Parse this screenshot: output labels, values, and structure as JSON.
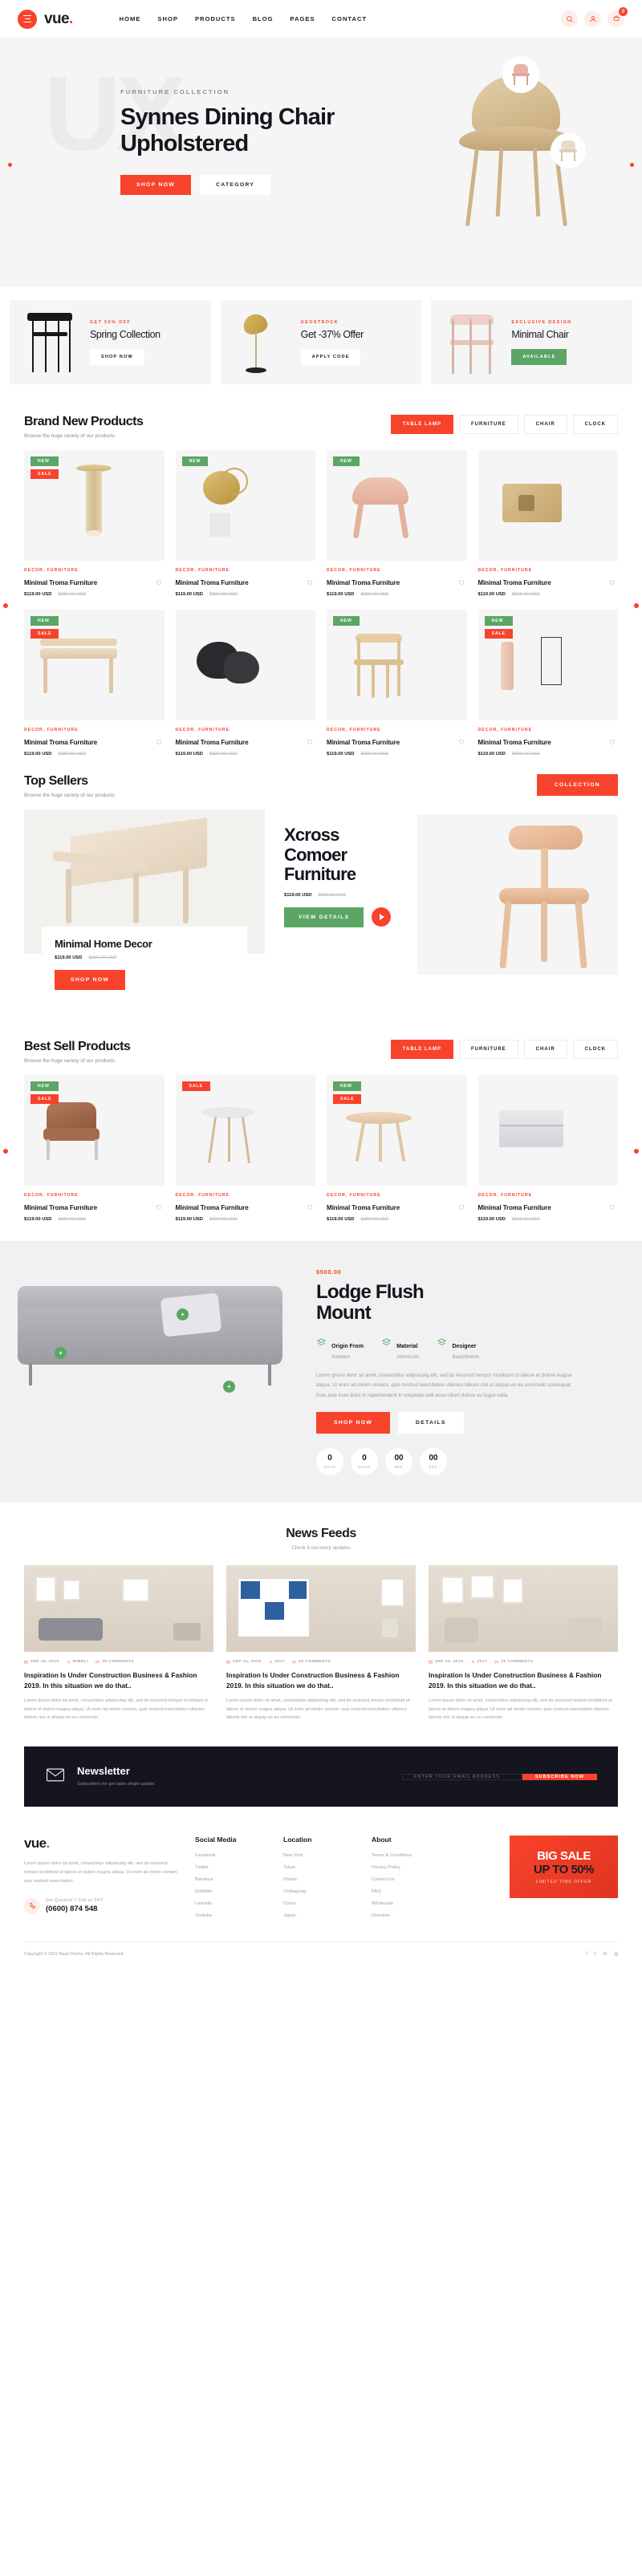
{
  "header": {
    "brand": "vue",
    "brand_dot": ".",
    "nav": [
      {
        "label": "HOME"
      },
      {
        "label": "SHOP"
      },
      {
        "label": "PRODUCTS"
      },
      {
        "label": "BLOG"
      },
      {
        "label": "PAGES"
      },
      {
        "label": "CONTACT"
      }
    ],
    "icons": {
      "search": "search-icon",
      "user": "user-icon",
      "cart": "cart-icon"
    },
    "cart_count": "0"
  },
  "hero": {
    "ghost_text": "UX",
    "kicker": "FURNITURE COLLECTION",
    "title": "Synnes Dining Chair Upholstered",
    "primary_btn": "SHOP NOW",
    "secondary_btn": "CATEGORY"
  },
  "promos": [
    {
      "kicker": "GET 50% OFF",
      "title": "Spring Collection",
      "btn": "SHOP NOW",
      "btn_style": "white"
    },
    {
      "kicker": "GEOSTROCK",
      "title": "Get -37% Offer",
      "btn": "APPLY CODE",
      "btn_style": "white"
    },
    {
      "kicker": "EXCLUSIVE DESIGN",
      "title": "Minimal Chair",
      "btn": "AVAILABLE",
      "btn_style": "green"
    }
  ],
  "brand_new": {
    "title": "Brand New Products",
    "subtitle": "Browse the huge variety of our products",
    "filters": [
      {
        "label": "TABLE LAMP",
        "active": true
      },
      {
        "label": "FURNITURE",
        "active": false
      },
      {
        "label": "CHAIR",
        "active": false
      },
      {
        "label": "CLOCK",
        "active": false
      }
    ],
    "products": [
      {
        "badges": [
          "NEW",
          "SALE"
        ],
        "category": "DECOR, FURNITURE",
        "name": "Minimal Troma Furniture",
        "price": "$119.00 USD",
        "price_old": "$330.00 USD"
      },
      {
        "badges": [
          "NEW"
        ],
        "category": "DECOR, FURNITURE",
        "name": "Minimal Troma Furniture",
        "price": "$119.00 USD",
        "price_old": "$330.00 USD"
      },
      {
        "badges": [
          "NEW"
        ],
        "category": "DECOR, FURNITURE",
        "name": "Minimal Troma Furniture",
        "price": "$119.00 USD",
        "price_old": "$330.00 USD"
      },
      {
        "badges": [],
        "category": "DECOR, FURNITURE",
        "name": "Minimal Troma Furniture",
        "price": "$119.00 USD",
        "price_old": "$330.00 USD"
      },
      {
        "badges": [
          "NEW",
          "SALE"
        ],
        "category": "DECOR, FURNITURE",
        "name": "Minimal Troma Furniture",
        "price": "$119.00 USD",
        "price_old": "$330.00 USD"
      },
      {
        "badges": [],
        "category": "DECOR, FURNITURE",
        "name": "Minimal Troma Furniture",
        "price": "$119.00 USD",
        "price_old": "$330.00 USD"
      },
      {
        "badges": [
          "NEW"
        ],
        "category": "DECOR, FURNITURE",
        "name": "Minimal Troma Furniture",
        "price": "$119.00 USD",
        "price_old": "$330.00 USD"
      },
      {
        "badges": [
          "NEW",
          "SALE"
        ],
        "category": "DECOR, FURNITURE",
        "name": "Minimal Troma Furniture",
        "price": "$119.00 USD",
        "price_old": "$330.00 USD"
      }
    ]
  },
  "top_sellers": {
    "title": "Top Sellers",
    "subtitle": "Browse the huge variety of our products",
    "collection_btn": "COLLECTION",
    "feature_card": {
      "name": "Minimal Home Decor",
      "price": "$119.00 USD",
      "price_old": "$330.00 USD",
      "btn": "SHOP NOW"
    },
    "feature_right": {
      "title": "Xcross Comoer Furniture",
      "price": "$119.00 USD",
      "price_old": "$330.00 USD",
      "btn": "VIEW DETAILS"
    }
  },
  "best_sell": {
    "title": "Best Sell Products",
    "subtitle": "Browse the huge variety of our products",
    "filters": [
      {
        "label": "TABLE LAMP",
        "active": true
      },
      {
        "label": "FURNITURE",
        "active": false
      },
      {
        "label": "CHAIR",
        "active": false
      },
      {
        "label": "CLOCK",
        "active": false
      }
    ],
    "products": [
      {
        "badges": [
          "NEW",
          "SALE"
        ],
        "category": "DECOR, FURNITURE",
        "name": "Minimal Troma Furniture",
        "price": "$119.00 USD",
        "price_old": "$330.00 USD"
      },
      {
        "badges": [
          "SALE"
        ],
        "category": "DECOR, FURNITURE",
        "name": "Minimal Troma Furniture",
        "price": "$119.00 USD",
        "price_old": "$330.00 USD"
      },
      {
        "badges": [
          "NEW",
          "SALE"
        ],
        "category": "DECOR, FURNITURE",
        "name": "Minimal Troma Furniture",
        "price": "$119.00 USD",
        "price_old": "$330.00 USD"
      },
      {
        "badges": [],
        "category": "DECOR, FURNITURE",
        "name": "Minimal Troma Furniture",
        "price": "$119.00 USD",
        "price_old": "$330.00 USD"
      }
    ]
  },
  "banner": {
    "price": "$500.00",
    "title": "Lodge Flush Mount",
    "features": [
      {
        "label": "Origin From",
        "value": "Sweden"
      },
      {
        "label": "Material",
        "value": "Aluminum"
      },
      {
        "label": "Designer",
        "value": "Basictheme"
      }
    ],
    "description": "Lorem ipsum dolor sit amet, consectetur adipisicing elit, sed do eiusmod tempor incididunt ut labore et dolore magna aliqua. Ut enim ad minim veniam, quis nostrud exercitation ullamco laboris nisi ut aliquip ex ea commodo consequat. Duis aute irure dolor in reprehenderit in voluptate velit esse cillum dolore eu fugiat nulla.",
    "primary_btn": "SHOP NOW",
    "secondary_btn": "DETAILS",
    "countdown": [
      {
        "num": "0",
        "label": "DAYS"
      },
      {
        "num": "0",
        "label": "HOUR"
      },
      {
        "num": "00",
        "label": "MIN"
      },
      {
        "num": "00",
        "label": "SEC"
      }
    ]
  },
  "news": {
    "title": "News Feeds",
    "subtitle": "Check it out every updates",
    "posts": [
      {
        "date": "SEP 15, 2019",
        "author": "BIMBLI",
        "comments": "25 COMMENTS",
        "title": "Inspiration Is Under Construction Business & Fashion 2019. In this situation we do that..",
        "excerpt": "Lorem ipsum dolor sit amet, consectetur adipisicing elit, sed do eiusmod tempor incididunt ut labore et dolore magna aliqua. Ut enim ad minim veniam, quis nostrud exercitation ullamco laboris nisi ut aliquip ex ea commodo."
      },
      {
        "date": "SEP 14, 2019",
        "author": "2017",
        "comments": "25 COMMENTS",
        "title": "Inspiration Is Under Construction Business & Fashion 2019. In this situation we do that..",
        "excerpt": "Lorem ipsum dolor sit amet, consectetur adipisicing elit, sed do eiusmod tempor incididunt ut labore et dolore magna aliqua. Ut enim ad minim veniam, quis nostrud exercitation ullamco laboris nisi ut aliquip ex ea commodo."
      },
      {
        "date": "SEP 14, 2019",
        "author": "2017",
        "comments": "25 COMMENTS",
        "title": "Inspiration Is Under Construction Business & Fashion 2019. In this situation we do that..",
        "excerpt": "Lorem ipsum dolor sit amet, consectetur adipisicing elit, sed do eiusmod tempor incididunt ut labore et dolore magna aliqua. Ut enim ad minim veniam, quis nostrud exercitation ullamco laboris nisi ut aliquip ex ea commodo."
      }
    ]
  },
  "newsletter": {
    "title": "Newsletter",
    "subtitle": "Subscribers for get sales single update.",
    "input_placeholder": "ENTER YOUR EMAIL ADDRESS",
    "btn": "SUBSCRIBE NOW"
  },
  "footer": {
    "brand": "vue",
    "brand_dot": ".",
    "about_text": "Lorem ipsum dolor sit amet, consectetur adipisicing elit, sed do eiusmod tempor incididunt ut labore et dolore magna aliqua. Ut enim ad minim veniam, quis nostrud exercitation.",
    "call_label": "Get Quickest ? Call us 24/7",
    "call_number": "(0600) 874 548",
    "columns": [
      {
        "heading": "Social Media",
        "links": [
          "Facebook",
          "Twitter",
          "Behance",
          "Dribbble",
          "Linkedin",
          "Youtube"
        ]
      },
      {
        "heading": "Location",
        "links": [
          "New York",
          "Tokyo",
          "Dhaka",
          "Chittagong",
          "China",
          "Japan"
        ]
      },
      {
        "heading": "About",
        "links": [
          "Terms & Conditions",
          "Privacy Policy",
          "Contact Us",
          "FAQ",
          "Wholesale",
          "Direction"
        ]
      }
    ],
    "promo": {
      "line1": "BIG SALE",
      "line2": "UP TO 50%",
      "line3": "LIMITED TIME OFFER"
    },
    "copyright": "Copyright © 2019 BasicTheme. All Rights Reserved",
    "socials": [
      "f",
      "t",
      "in",
      "ig"
    ]
  },
  "colors": {
    "accent": "#f8432c",
    "green": "#5ba664",
    "dark": "#151520",
    "light_bg": "#f5f5f5"
  }
}
